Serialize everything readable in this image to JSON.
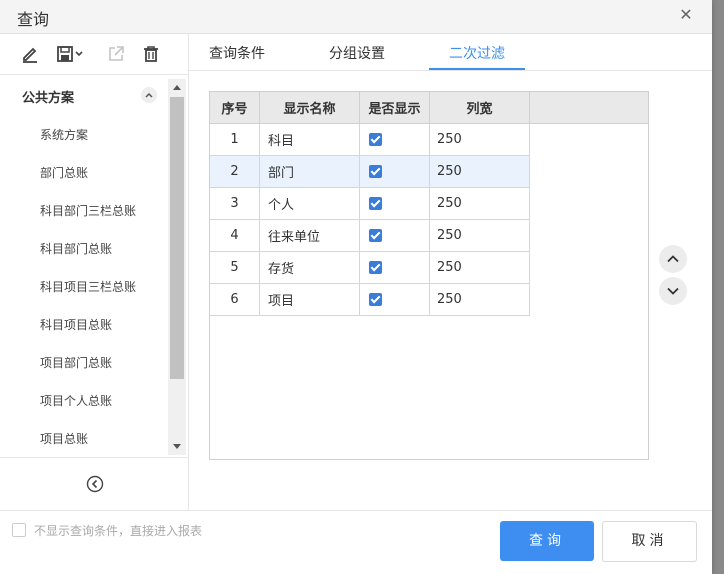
{
  "dialog": {
    "title": "查询",
    "close_icon": "close-icon"
  },
  "toolbar": {
    "icons": [
      "edit-icon",
      "save-icon",
      "export-icon",
      "delete-icon"
    ]
  },
  "left": {
    "group_title": "公共方案",
    "items": [
      "系统方案",
      "部门总账",
      "科目部门三栏总账",
      "科目部门总账",
      "科目项目三栏总账",
      "科目项目总账",
      "项目部门总账",
      "项目个人总账",
      "项目总账"
    ]
  },
  "tabs": [
    {
      "label": "查询条件",
      "active": false
    },
    {
      "label": "分组设置",
      "active": false
    },
    {
      "label": "二次过滤",
      "active": true
    }
  ],
  "grid": {
    "headers": {
      "seq": "序号",
      "name": "显示名称",
      "show": "是否显示",
      "width": "列宽"
    },
    "rows": [
      {
        "seq": "1",
        "name": "科目",
        "show": true,
        "width": "250"
      },
      {
        "seq": "2",
        "name": "部门",
        "show": true,
        "width": "250",
        "selected": true
      },
      {
        "seq": "3",
        "name": "个人",
        "show": true,
        "width": "250"
      },
      {
        "seq": "4",
        "name": "往来单位",
        "show": true,
        "width": "250"
      },
      {
        "seq": "5",
        "name": "存货",
        "show": true,
        "width": "250"
      },
      {
        "seq": "6",
        "name": "项目",
        "show": true,
        "width": "250"
      }
    ]
  },
  "footer": {
    "option_label": "不显示查询条件，直接进入报表",
    "query_label": "查询",
    "cancel_label": "取消"
  },
  "colors": {
    "accent": "#3d8ef0",
    "checkbox": "#3a7dd8",
    "selected_row": "#eaf3fd"
  }
}
